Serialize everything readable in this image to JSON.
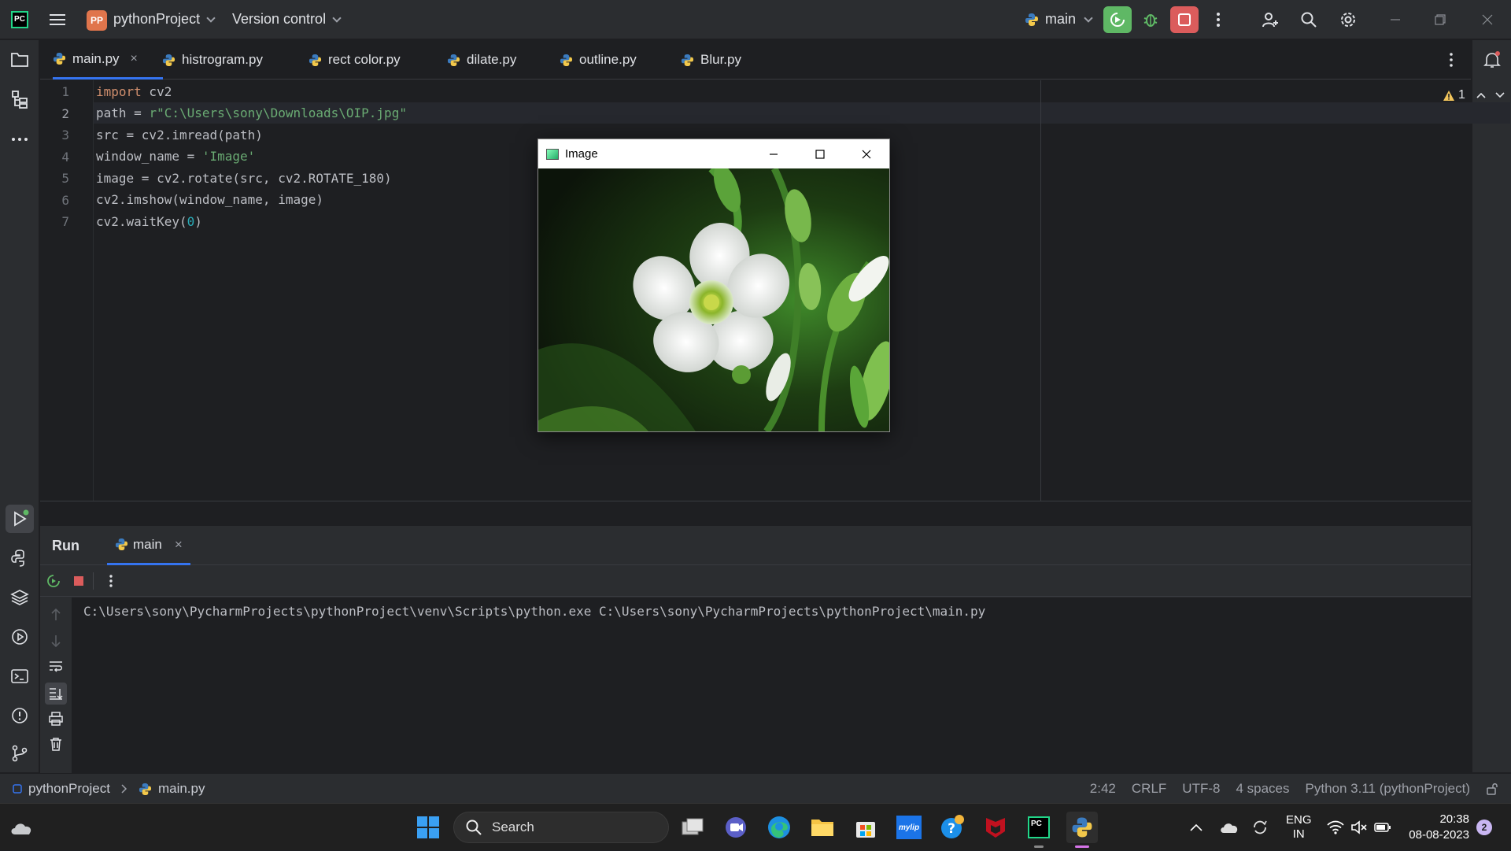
{
  "titlebar": {
    "logo": "PC",
    "project_badge": "PP",
    "project_name": "pythonProject",
    "version_control": "Version control",
    "run_config": "main",
    "icons": [
      "hamburger-icon",
      "run-icon",
      "debug-icon",
      "stop-icon",
      "more-icon",
      "add-user-icon",
      "search-icon",
      "gear-icon",
      "minimize-icon",
      "restore-icon",
      "close-icon"
    ]
  },
  "tabs": [
    {
      "label": "main.py",
      "active": true
    },
    {
      "label": "histrogram.py"
    },
    {
      "label": "rect color.py"
    },
    {
      "label": "dilate.py"
    },
    {
      "label": "outline.py"
    },
    {
      "label": "Blur.py"
    }
  ],
  "tab_close": "×",
  "editor": {
    "line_numbers": [
      "1",
      "2",
      "3",
      "4",
      "5",
      "6",
      "7"
    ],
    "lines": {
      "l1_kw": "import",
      "l1_rest": " cv2",
      "l2_a": "path = ",
      "l2_str": "r\"C:\\Users\\sony\\Downloads\\OIP.jpg\"",
      "l3": "src = cv2.imread(path)",
      "l4_a": "window_name = ",
      "l4_str": "'Image'",
      "l5": "image = cv2.rotate(src, cv2.ROTATE_180)",
      "l6": "cv2.imshow(window_name, image)",
      "l7_a": "cv2.waitKey(",
      "l7_num": "0",
      "l7_b": ")"
    },
    "warning_count": "1"
  },
  "run_panel": {
    "title": "Run",
    "tab": "main",
    "tab_close": "×",
    "console": "C:\\Users\\sony\\PycharmProjects\\pythonProject\\venv\\Scripts\\python.exe C:\\Users\\sony\\PycharmProjects\\pythonProject\\main.py"
  },
  "image_window": {
    "title": "Image"
  },
  "statusbar": {
    "project": "pythonProject",
    "file": "main.py",
    "position": "2:42",
    "line_sep": "CRLF",
    "encoding": "UTF-8",
    "indent": "4 spaces",
    "interpreter": "Python 3.11 (pythonProject)"
  },
  "taskbar": {
    "search": "Search",
    "lang_top": "ENG",
    "lang_bottom": "IN",
    "time": "20:38",
    "date": "08-08-2023",
    "notifications": "2",
    "mcafee_label": "mylip"
  },
  "colors": {
    "accent": "#3574f0",
    "run_green": "#5fb865",
    "stop_red": "#db5c5c",
    "keyword": "#cf8e6d",
    "string": "#6aab73",
    "number": "#2aacb8"
  }
}
